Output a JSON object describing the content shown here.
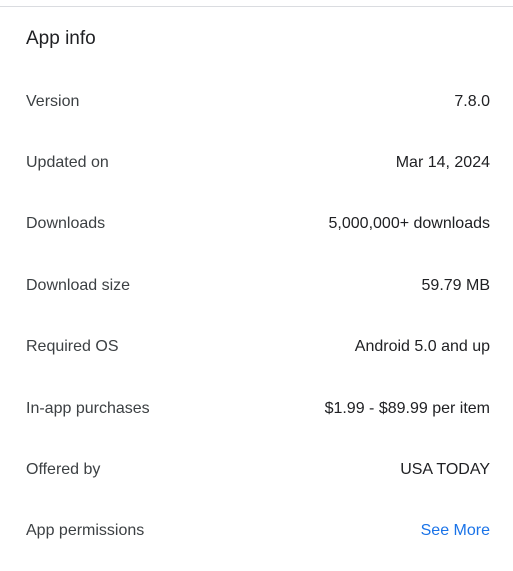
{
  "section": {
    "title": "App info"
  },
  "rows": [
    {
      "label": "Version",
      "value": "7.8.0"
    },
    {
      "label": "Updated on",
      "value": "Mar 14, 2024"
    },
    {
      "label": "Downloads",
      "value": "5,000,000+ downloads"
    },
    {
      "label": "Download size",
      "value": "59.79 MB"
    },
    {
      "label": "Required OS",
      "value": "Android 5.0 and up"
    },
    {
      "label": "In-app purchases",
      "value": "$1.99 - $89.99 per item"
    },
    {
      "label": "Offered by",
      "value": "USA TODAY"
    },
    {
      "label": "App permissions",
      "value": "See More"
    }
  ],
  "colors": {
    "link": "#1a73e8",
    "text": "#202124",
    "label": "#3c4043",
    "divider": "#dadce0"
  }
}
